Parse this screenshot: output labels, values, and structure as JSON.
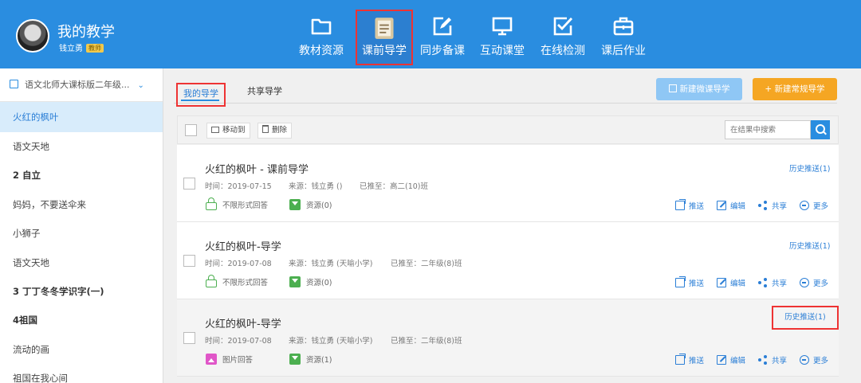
{
  "brand": {
    "title": "我的教学",
    "user": "钱立勇",
    "badge": "教师"
  },
  "nav": [
    {
      "label": "教材资源",
      "icon": "folder-icon",
      "active": false
    },
    {
      "label": "课前导学",
      "icon": "clipboard-icon",
      "active": true
    },
    {
      "label": "同步备课",
      "icon": "edit-icon",
      "active": false
    },
    {
      "label": "互动课堂",
      "icon": "monitor-icon",
      "active": false
    },
    {
      "label": "在线检测",
      "icon": "checkbox-icon",
      "active": false
    },
    {
      "label": "课后作业",
      "icon": "briefcase-icon",
      "active": false
    }
  ],
  "sidebar": {
    "header": "语文北师大课标版二年级...",
    "items": [
      {
        "label": "火红的枫叶",
        "active": true,
        "bold": false
      },
      {
        "label": "语文天地",
        "active": false,
        "bold": false
      },
      {
        "label": "2 自立",
        "active": false,
        "bold": true
      },
      {
        "label": "妈妈，不要送伞来",
        "active": false,
        "bold": false
      },
      {
        "label": "小狮子",
        "active": false,
        "bold": false
      },
      {
        "label": "语文天地",
        "active": false,
        "bold": false
      },
      {
        "label": "3 丁丁冬冬学识字(一)",
        "active": false,
        "bold": true
      },
      {
        "label": "4祖国",
        "active": false,
        "bold": true
      },
      {
        "label": "流动的画",
        "active": false,
        "bold": false
      },
      {
        "label": "祖国在我心间",
        "active": false,
        "bold": false
      }
    ]
  },
  "tabs": {
    "mine": "我的导学",
    "shared": "共享导学"
  },
  "buttons": {
    "new_micro": "新建微课导学",
    "new_regular": "+ 新建常规导学"
  },
  "toolbar": {
    "move": "移动到",
    "delete": "删除",
    "search_placeholder": "在结果中搜索"
  },
  "actions": {
    "push": "推送",
    "edit": "编辑",
    "share": "共享",
    "more": "更多"
  },
  "cards": [
    {
      "title": "火红的枫叶 - 课前导学",
      "time": "时间：2019-07-15",
      "source": "来源：钱立勇 ()",
      "pushed": "已推至：高二(10)班",
      "answer": "不限形式回答",
      "answer_icon": "unlock-icon",
      "resources": "资源(0)",
      "history": "历史推送(1)"
    },
    {
      "title": "火红的枫叶-导学",
      "time": "时间：2019-07-08",
      "source": "来源：钱立勇 (天喻小学)",
      "pushed": "已推至：二年级(8)班",
      "answer": "不限形式回答",
      "answer_icon": "unlock-icon",
      "resources": "资源(0)",
      "history": "历史推送(1)"
    },
    {
      "title": "火红的枫叶-导学",
      "time": "时间：2019-07-08",
      "source": "来源：钱立勇 (天喻小学)",
      "pushed": "已推至：二年级(8)班",
      "answer": "图片回答",
      "answer_icon": "image-icon",
      "resources": "资源(1)",
      "history": "历史推送(1)"
    }
  ]
}
